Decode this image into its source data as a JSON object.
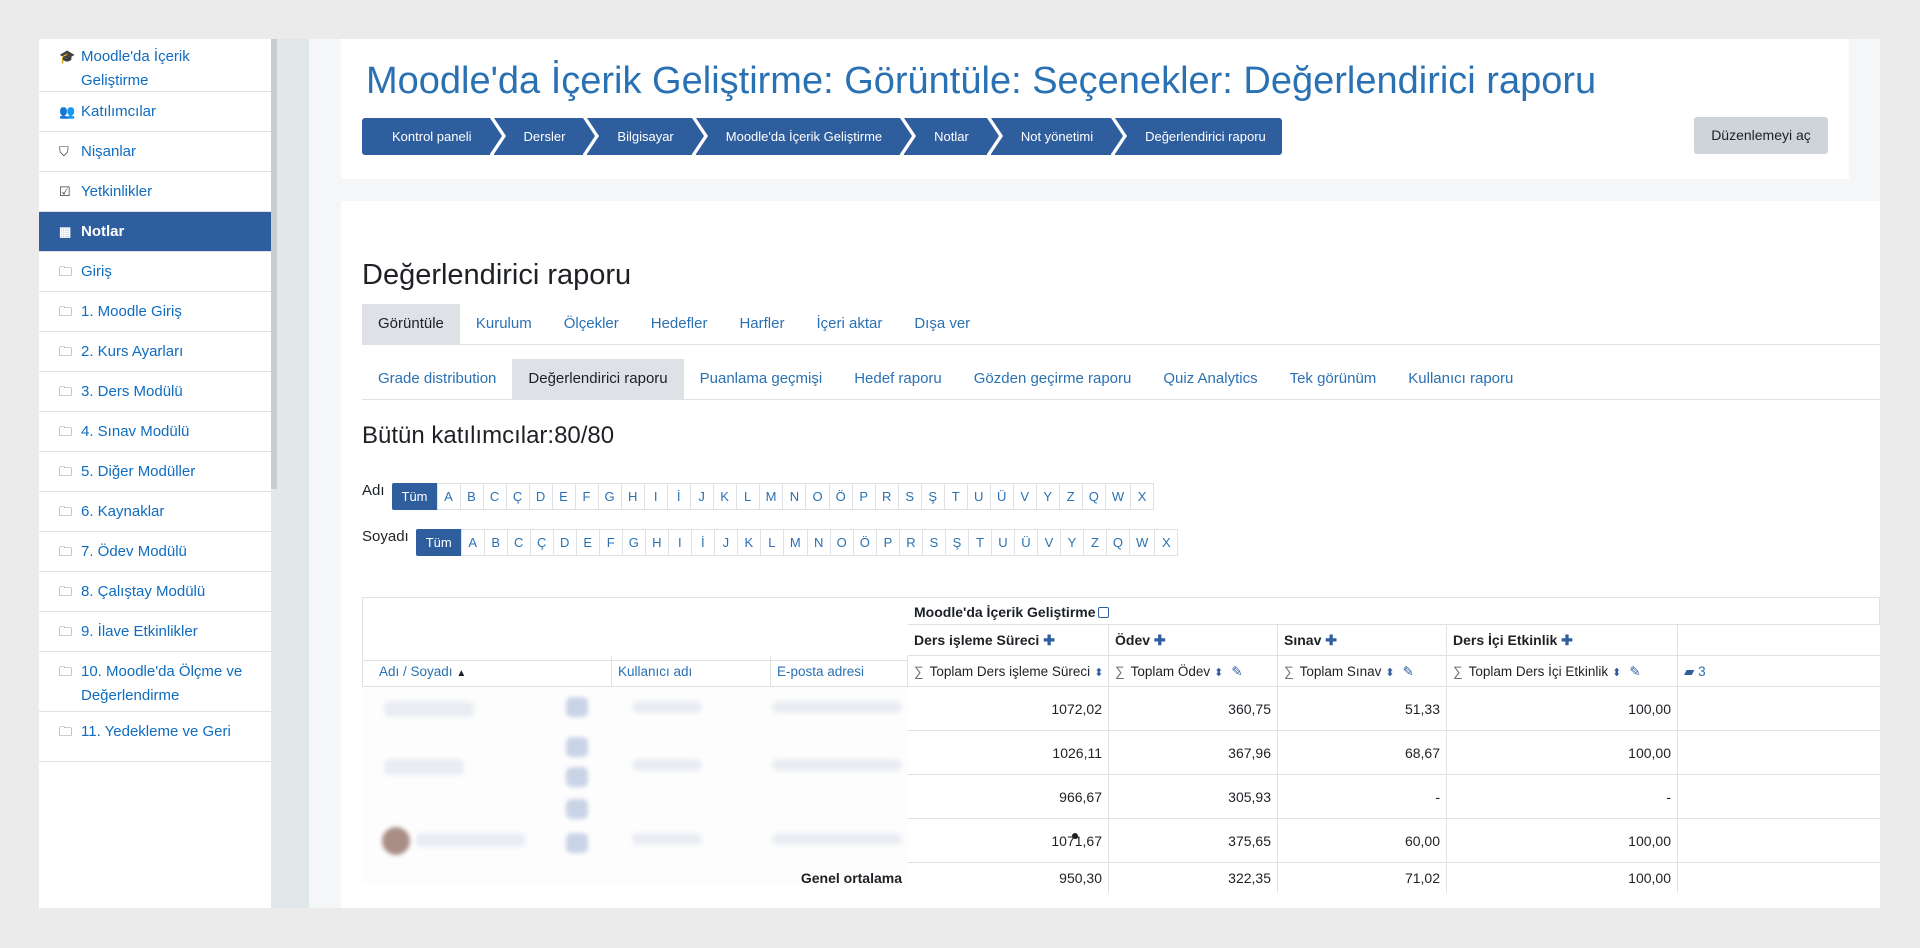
{
  "sidebar": {
    "items": [
      {
        "icon": "graduation-cap-icon",
        "glyph": "🎓",
        "label": "Moodle'da İçerik Geliştirme"
      },
      {
        "icon": "users-icon",
        "glyph": "👥",
        "label": "Katılımcılar"
      },
      {
        "icon": "shield-icon",
        "glyph": "⛉",
        "label": "Nişanlar"
      },
      {
        "icon": "checkbox-icon",
        "glyph": "☑",
        "label": "Yetkinlikler"
      },
      {
        "icon": "table-icon",
        "glyph": "▦",
        "label": "Notlar",
        "active": true
      },
      {
        "icon": "folder-icon",
        "glyph": "🗀",
        "label": "Giriş"
      },
      {
        "icon": "folder-icon",
        "glyph": "🗀",
        "label": "1. Moodle Giriş"
      },
      {
        "icon": "folder-icon",
        "glyph": "🗀",
        "label": "2. Kurs Ayarları"
      },
      {
        "icon": "folder-icon",
        "glyph": "🗀",
        "label": "3. Ders Modülü"
      },
      {
        "icon": "folder-icon",
        "glyph": "🗀",
        "label": "4. Sınav Modülü"
      },
      {
        "icon": "folder-icon",
        "glyph": "🗀",
        "label": "5. Diğer Modüller"
      },
      {
        "icon": "folder-icon",
        "glyph": "🗀",
        "label": "6. Kaynaklar"
      },
      {
        "icon": "folder-icon",
        "glyph": "🗀",
        "label": "7. Ödev Modülü"
      },
      {
        "icon": "folder-icon",
        "glyph": "🗀",
        "label": "8. Çalıştay Modülü"
      },
      {
        "icon": "folder-icon",
        "glyph": "🗀",
        "label": "9. İlave Etkinlikler"
      },
      {
        "icon": "folder-icon",
        "glyph": "🗀",
        "label": "10. Moodle'da Ölçme ve Değerlendirme"
      },
      {
        "icon": "folder-icon",
        "glyph": "🗀",
        "label": "11. Yedekleme ve Geri"
      }
    ]
  },
  "header": {
    "title": "Moodle'da İçerik Geliştirme: Görüntüle: Seçenekler: Değerlendirici raporu",
    "breadcrumbs": [
      "Kontrol paneli",
      "Dersler",
      "Bilgisayar",
      "Moodle'da İçerik Geliştirme",
      "Notlar",
      "Not yönetimi",
      "Değerlendirici raporu"
    ],
    "edit_button": "Düzenlemeyi aç"
  },
  "main": {
    "section_title": "Değerlendirici raporu",
    "tabs_primary": [
      "Görüntüle",
      "Kurulum",
      "Ölçekler",
      "Hedefler",
      "Harfler",
      "İçeri aktar",
      "Dışa ver"
    ],
    "tabs_secondary": [
      "Grade distribution",
      "Değerlendirici raporu",
      "Puanlama geçmişi",
      "Hedef raporu",
      "Gözden geçirme raporu",
      "Quiz Analytics",
      "Tek görünüm",
      "Kullanıcı raporu"
    ],
    "participants": "Bütün katılımcılar:80/80",
    "first_name_label": "Adı",
    "last_name_label": "Soyadı",
    "all_label": "Tüm",
    "letters": [
      "A",
      "B",
      "C",
      "Ç",
      "D",
      "E",
      "F",
      "G",
      "H",
      "I",
      "İ",
      "J",
      "K",
      "L",
      "M",
      "N",
      "O",
      "Ö",
      "P",
      "R",
      "S",
      "Ş",
      "T",
      "U",
      "Ü",
      "V",
      "Y",
      "Z",
      "Q",
      "W",
      "X"
    ]
  },
  "grader": {
    "course_header": "Moodle'da İçerik Geliştirme",
    "categories": [
      {
        "name": "Ders işleme Süreci",
        "total": "Toplam Ders işleme Süreci"
      },
      {
        "name": "Ödev",
        "total": "Toplam Ödev"
      },
      {
        "name": "Sınav",
        "total": "Toplam Sınav"
      },
      {
        "name": "Ders İçi Etkinlik",
        "total": "Toplam Ders İçi Etkinlik"
      }
    ],
    "extra_col": "3",
    "columns": {
      "name": "Adı / Soyadı",
      "username": "Kullanıcı adı",
      "email": "E-posta adresi"
    },
    "rows": [
      [
        "1072,02",
        "360,75",
        "51,33",
        "100,00"
      ],
      [
        "1026,11",
        "367,96",
        "68,67",
        "100,00"
      ],
      [
        "966,67",
        "305,93",
        "-",
        "-"
      ],
      [
        "1071,67",
        "375,65",
        "60,00",
        "100,00"
      ]
    ],
    "average_label": "Genel ortalama",
    "average": [
      "950,30",
      "322,35",
      "71,02",
      "100,00"
    ]
  }
}
